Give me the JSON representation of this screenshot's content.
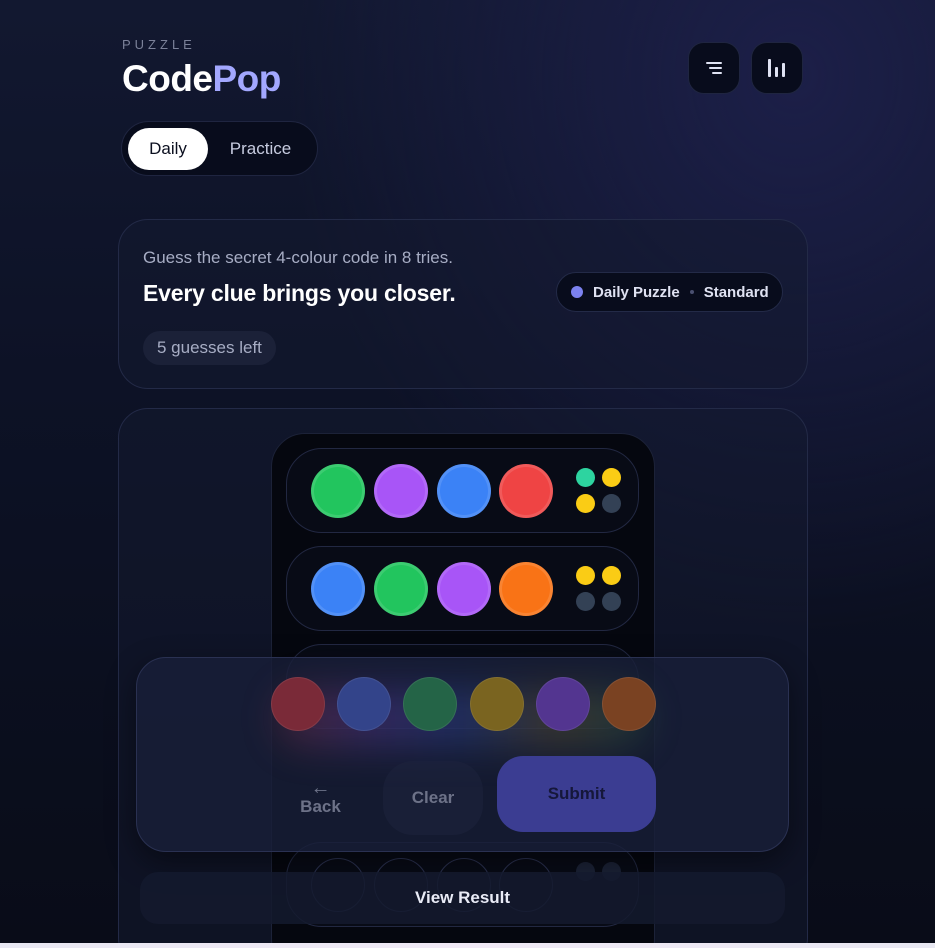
{
  "header": {
    "eyebrow": "PUZZLE",
    "title_part1": "Code",
    "title_part2": "Pop",
    "menu_icon": "menu-lines-icon",
    "stats_icon": "bar-chart-icon"
  },
  "mode_tabs": [
    {
      "label": "Daily",
      "selected": true
    },
    {
      "label": "Practice",
      "selected": false
    }
  ],
  "intro": {
    "description": "Guess the secret 4-colour code in 8 tries.",
    "headline": "Every clue brings you closer.",
    "guesses_left": "5 guesses left",
    "puzzle_type": "Daily Puzzle",
    "difficulty": "Standard",
    "accent_color": "#7c82f0"
  },
  "rows": [
    {
      "pegs": [
        "#22c55e",
        "#a855f7",
        "#3b82f6",
        "#ef4444"
      ],
      "feedback": [
        "#2dd4a0",
        "#facc15",
        "#facc15",
        "#334155"
      ]
    },
    {
      "pegs": [
        "#3b82f6",
        "#22c55e",
        "#a855f7",
        "#f97316"
      ],
      "feedback": [
        "#facc15",
        "#facc15",
        "#334155",
        "#334155"
      ]
    }
  ],
  "palette": [
    {
      "name": "red",
      "color": "#7a2a38"
    },
    {
      "name": "blue",
      "color": "#33448a"
    },
    {
      "name": "green",
      "color": "#246447"
    },
    {
      "name": "yellow",
      "color": "#7a6420"
    },
    {
      "name": "purple",
      "color": "#533590"
    },
    {
      "name": "orange",
      "color": "#7a4222"
    }
  ],
  "actions": {
    "back_arrow": "←",
    "back_label": "Back",
    "clear_label": "Clear",
    "submit_label": "Submit"
  },
  "view_result_label": "View Result"
}
